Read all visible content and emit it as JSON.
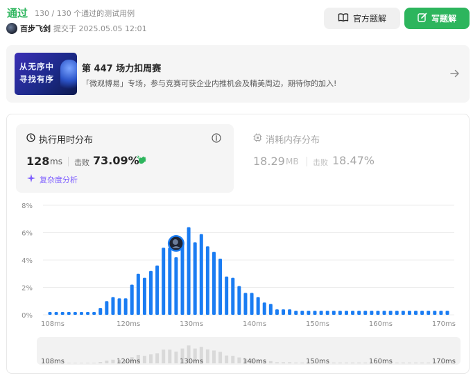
{
  "header": {
    "status": "通过",
    "count_text": "130 / 130 个通过的测试用例",
    "username": "百步飞剑",
    "submitted_text": "提交于 2025.05.05 12:01",
    "official_solution_label": "官方题解",
    "write_solution_label": "写题解"
  },
  "banner": {
    "image_text_line1": "从无序中",
    "image_text_line2": "寻找有序",
    "title": "第 447 场力扣周赛",
    "description": "「微观博易」专场，参与竞赛可获企业内推机会及精美周边，期待你的加入!",
    "arrow_icon": "arrow-right-icon"
  },
  "runtime": {
    "title": "执行用时分布",
    "value": "128",
    "unit": "ms",
    "beat_label": "击败",
    "beat_value": "73.09%",
    "analysis_label": "复杂度分析"
  },
  "memory": {
    "title": "消耗内存分布",
    "value": "18.29",
    "unit": "MB",
    "beat_label": "击败",
    "beat_value": "18.47%"
  },
  "colors": {
    "accent_green": "#2db55d",
    "bar_blue": "#1a7cf2",
    "purple": "#7c5cff"
  },
  "chart_data": {
    "type": "bar",
    "title": "",
    "xlabel": "",
    "ylabel": "",
    "ylim": [
      0,
      8
    ],
    "y_ticks": [
      "0%",
      "2%",
      "4%",
      "6%",
      "8%"
    ],
    "x_ticks": [
      "108ms",
      "120ms",
      "130ms",
      "140ms",
      "150ms",
      "160ms",
      "170ms"
    ],
    "x_tick_values": [
      108,
      120,
      130,
      140,
      150,
      160,
      170
    ],
    "x_range": [
      107.5,
      171.5
    ],
    "bar_x": [
      108,
      109,
      110,
      111,
      112,
      113,
      114,
      115,
      116,
      117,
      118,
      119,
      120,
      121,
      122,
      123,
      124,
      125,
      126,
      127,
      128,
      129,
      130,
      131,
      132,
      133,
      134,
      135,
      136,
      137,
      138,
      139,
      140,
      141,
      142,
      143,
      144,
      145,
      146,
      147,
      148,
      149,
      150,
      151,
      152,
      153,
      154,
      155,
      156,
      157,
      158,
      159,
      160,
      161,
      162,
      163,
      164,
      165,
      166,
      167,
      168,
      169,
      170,
      171
    ],
    "values": [
      0.2,
      0.2,
      0.2,
      0.2,
      0.2,
      0.2,
      0.2,
      0.2,
      0.5,
      1.0,
      1.3,
      1.2,
      1.2,
      2.2,
      3.0,
      2.7,
      3.2,
      3.6,
      4.9,
      4.9,
      4.2,
      5.3,
      6.4,
      5.3,
      5.9,
      5.0,
      4.6,
      4.1,
      2.8,
      2.7,
      2.1,
      1.6,
      1.6,
      1.3,
      0.9,
      0.8,
      0.4,
      0.4,
      0.4,
      0.3,
      0.3,
      0.3,
      0.3,
      0.3,
      0.3,
      0.3,
      0.3,
      0.3,
      0.3,
      0.3,
      0.3,
      0.3,
      0.3,
      0.3,
      0.3,
      0.3,
      0.3,
      0.3,
      0.3,
      0.3,
      0.3,
      0.3,
      0.3,
      0.3
    ],
    "grid": true,
    "marker_x": 128,
    "marker_icon": "user-avatar-icon"
  }
}
